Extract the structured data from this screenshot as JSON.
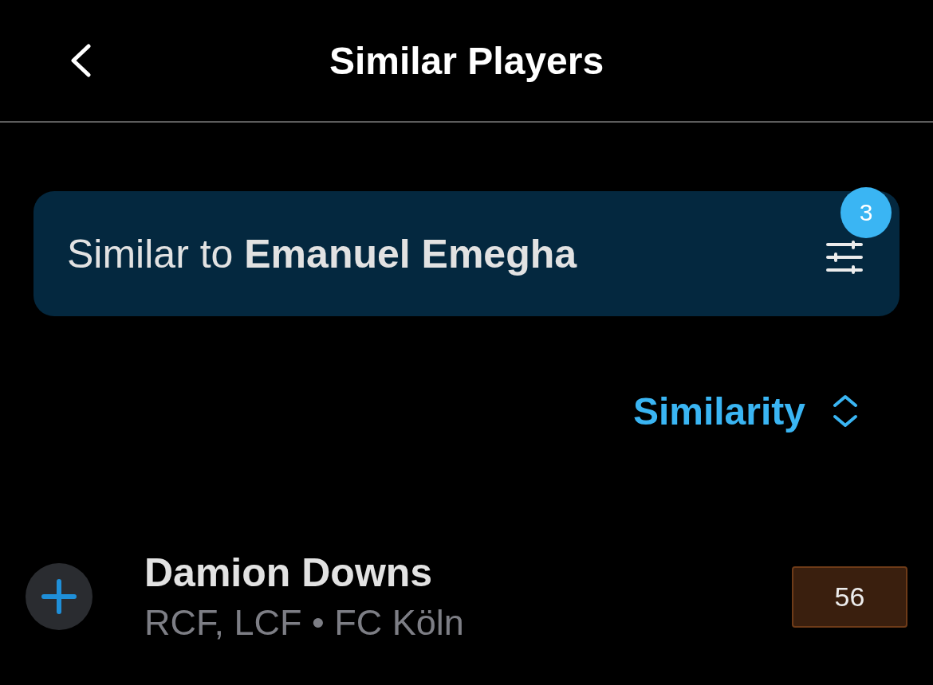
{
  "header": {
    "title": "Similar Players"
  },
  "filter": {
    "text": "Similar to **Emanuel Emegha**",
    "badge": "3"
  },
  "sort": {
    "label": "Similarity"
  },
  "players": [
    {
      "name": "Damion Downs",
      "details": "RCF, LCF • FC Köln",
      "score": "56",
      "color": "#3a1f0e"
    }
  ]
}
